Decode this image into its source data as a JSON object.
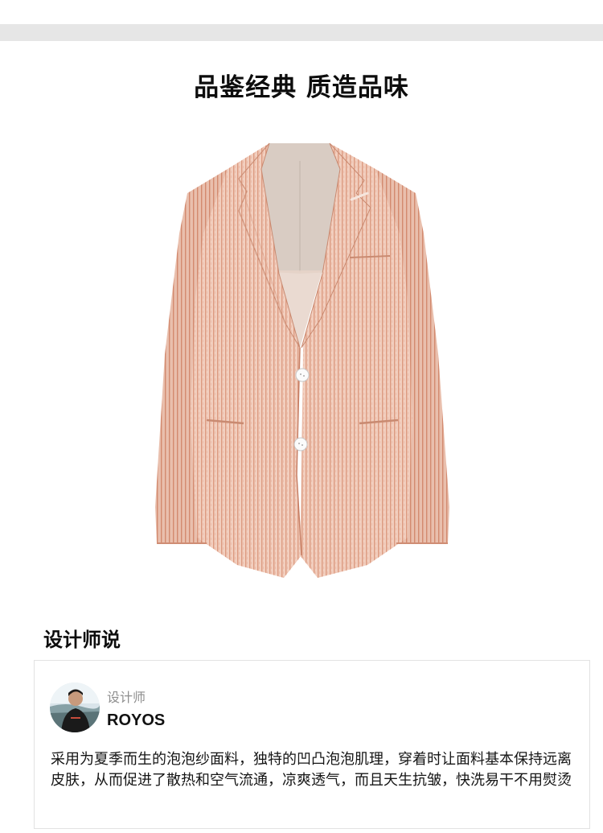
{
  "colors": {
    "band": "#e6e6e6",
    "jacket": "#efc9b8",
    "stripe": "#d88f74",
    "lining": "#d8cbc2",
    "text": "#111111",
    "muted": "#8e8e8e",
    "border": "#e2e2e2"
  },
  "headline": "品鉴经典  质造品味",
  "product": {
    "image_alt": "pink seersucker suit jacket"
  },
  "section": {
    "title": "设计师说"
  },
  "designer": {
    "role": "设计师",
    "name": "ROYOS",
    "avatar_icon": "designer-avatar",
    "quote": "采用为夏季而生的泡泡纱面料，独特的凹凸泡泡肌理，穿着时让面料基本保持远离皮肤，从而促进了散热和空气流通，凉爽透气，而且天生抗皱，快洗易干不用熨烫"
  }
}
